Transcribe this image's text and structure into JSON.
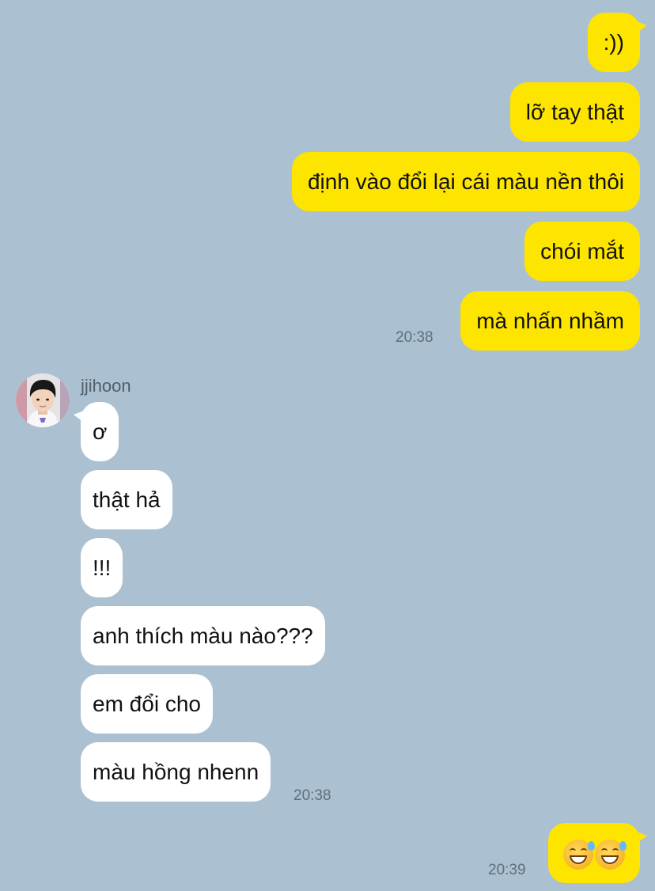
{
  "conversation": {
    "outgoing_group_1": {
      "messages": [
        ":))",
        "lỡ tay thật",
        "định vào đổi lại cái màu nền thôi",
        "chói mắt",
        "mà nhấn nhầm"
      ],
      "time": "20:38"
    },
    "incoming_group": {
      "sender": "jjihoon",
      "messages": [
        "ơ",
        "thật hả",
        "!!!",
        "anh thích màu nào???",
        "em đổi cho",
        "màu hồng nhenn"
      ],
      "time": "20:38"
    },
    "outgoing_group_2": {
      "emoji": [
        "grinning-sweat-emoji",
        "grinning-sweat-emoji"
      ],
      "time": "20:39"
    }
  },
  "colors": {
    "background": "#abc1d1",
    "outgoing_bubble": "#fee500",
    "incoming_bubble": "#ffffff"
  }
}
